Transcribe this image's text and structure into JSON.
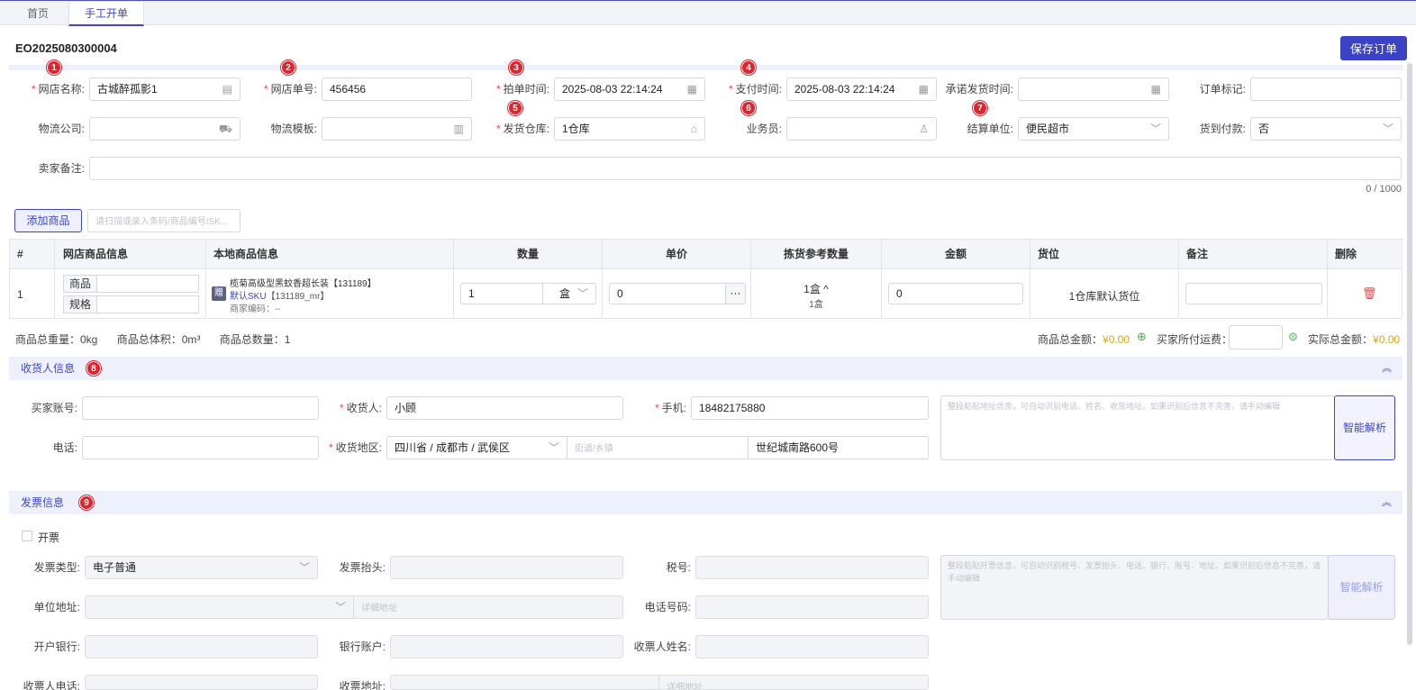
{
  "tabs": {
    "home": "首页",
    "manual_order": "手工开单"
  },
  "order_no": "EO2025080300004",
  "save_order": "保存订单",
  "badges": [
    "1",
    "2",
    "3",
    "4",
    "5",
    "6",
    "7",
    "8",
    "9"
  ],
  "fields": {
    "shop_name": {
      "label": "网店名称:",
      "value": "古城醉孤影1"
    },
    "shop_order_no": {
      "label": "网店单号:",
      "value": "456456"
    },
    "bid_time": {
      "label": "拍单时间:",
      "value": "2025-08-03 22:14:24"
    },
    "pay_time": {
      "label": "支付时间:",
      "value": "2025-08-03 22:14:24"
    },
    "promise_ship_time": {
      "label": "承诺发货时间:",
      "value": ""
    },
    "order_mark": {
      "label": "订单标记:",
      "value": ""
    },
    "logistics_company": {
      "label": "物流公司:",
      "value": ""
    },
    "logistics_template": {
      "label": "物流模板:",
      "value": ""
    },
    "ship_warehouse": {
      "label": "发货仓库:",
      "value": "1仓库"
    },
    "salesman": {
      "label": "业务员:",
      "value": ""
    },
    "settle_unit": {
      "label": "结算单位:",
      "value": "便民超市"
    },
    "cod": {
      "label": "货到付款:",
      "value": "否"
    },
    "seller_memo": {
      "label": "卖家备注:",
      "value": "",
      "counter": "0 / 1000"
    }
  },
  "add_goods": {
    "button": "添加商品",
    "placeholder": "请扫描或录入条码/商品编号/SK..."
  },
  "table": {
    "headers": [
      "#",
      "网店商品信息",
      "本地商品信息",
      "数量",
      "单价",
      "拣货参考数量",
      "金额",
      "货位",
      "备注",
      "删除"
    ],
    "row": {
      "index": "1",
      "shop_goods_label": "商品",
      "shop_spec_label": "规格",
      "gift_tag": "赠",
      "local_name": "榄菊高级型黑蚊香超长装【131189】",
      "local_sku_link": "默认SKU",
      "local_sku_code": "【131189_mr】",
      "merchant_code": "商家编码：--",
      "qty": "1",
      "unit": "盒",
      "price": "0",
      "price_more": "···",
      "pick_qty": "1盒 ^",
      "pick_qty_sub": "1盒",
      "amount": "0",
      "location": "1仓库默认货位",
      "remark": ""
    }
  },
  "summary": {
    "total_weight": "商品总重量：0kg",
    "total_volume": "商品总体积：0m³",
    "total_qty": "商品总数量：1",
    "goods_amount_label": "商品总金额：",
    "goods_amount": "¥0.00",
    "buyer_freight_label": "买家所付运费：",
    "actual_amount_label": "实际总金额：",
    "actual_amount": "¥0.00"
  },
  "receiver": {
    "title": "收货人信息",
    "buyer_account_label": "买家账号:",
    "receiver_label": "收货人:",
    "receiver_value": "小顾",
    "mobile_label": "手机:",
    "mobile_value": "18482175880",
    "phone_label": "电话:",
    "region_label": "收货地区:",
    "region_value": "四川省 / 成都市 / 武侯区",
    "street_placeholder": "街道/乡镇",
    "address_value": "世纪城南路600号",
    "paste_hint": "整段粘贴地址信息，可自动识别电话、姓名、收货地址。如果识别后信息不完善，请手动编辑",
    "parse_button": "智能解析"
  },
  "invoice": {
    "title": "发票信息",
    "checkbox_label": "开票",
    "type_label": "发票类型:",
    "type_value": "电子普通",
    "header_label": "发票抬头:",
    "tax_no_label": "税号:",
    "company_addr_label": "单位地址:",
    "addr_detail_placeholder": "详细地址",
    "phone_label": "电话号码:",
    "bank_label": "开户银行:",
    "bank_account_label": "银行账户:",
    "recipient_name_label": "收票人姓名:",
    "recipient_phone_label": "收票人电话:",
    "recipient_addr_label": "收票地址:",
    "detail_placeholder": "详细地址",
    "paste_hint": "整段粘贴开票信息，可自动识别税号、发票抬头、电话、银行、账号、地址。如果识别后信息不完善，请手动编辑",
    "parse_button": "智能解析"
  }
}
